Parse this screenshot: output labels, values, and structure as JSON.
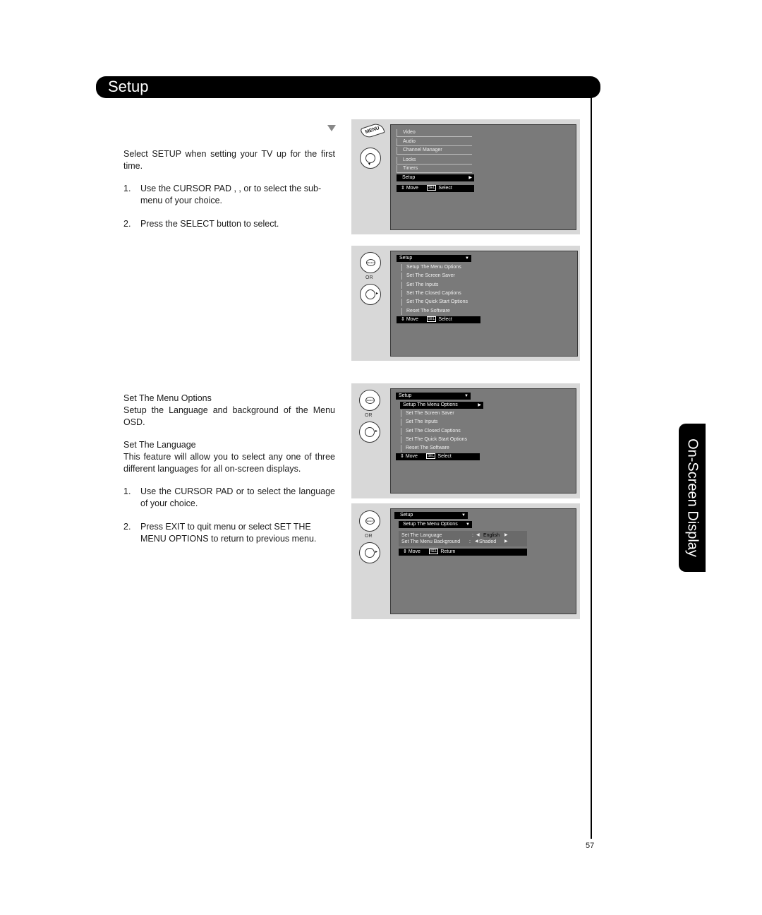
{
  "header": {
    "title": "Setup"
  },
  "side_tab": {
    "label": "On-Screen Display"
  },
  "page_number": "57",
  "section1": {
    "intro": "Select SETUP when setting your TV up for the first time.",
    "steps": [
      {
        "num": "1.",
        "text": "Use the CURSOR PAD   ,   ,    or    to select the sub-menu of your choice."
      },
      {
        "num": "2.",
        "text": "Press the SELECT button to select."
      }
    ]
  },
  "section2": {
    "heading": "Set The Menu Options",
    "desc": "Setup the Language and background of the Menu OSD.",
    "sub_heading": "Set The Language",
    "sub_desc": "This feature will allow you to select any one of three different languages for all on-screen displays.",
    "steps": [
      {
        "num": "1.",
        "text": "Use the CURSOR PAD    or    to select the language of your choice."
      },
      {
        "num": "2.",
        "text": "Press EXIT to quit menu or select SET THE MENU OPTIONS to return to previous menu."
      }
    ]
  },
  "remote": {
    "menu_label": "MENU",
    "select_label": "SELECT",
    "or_label": "OR"
  },
  "screen1": {
    "items": [
      "Video",
      "Audio",
      "Channel Manager",
      "Locks",
      "Timers"
    ],
    "selected": "Setup",
    "status": {
      "move": "Move",
      "sel_key": "SEL",
      "action": "Select"
    }
  },
  "screen2": {
    "title": "Setup",
    "items": [
      "Setup The Menu Options",
      "Set The Screen Saver",
      "Set The Inputs",
      "Set The Closed Captions",
      "Set The Quick Start Options",
      "Reset The Software"
    ],
    "status": {
      "move": "Move",
      "sel_key": "SEL",
      "action": "Select"
    }
  },
  "screen3": {
    "title": "Setup",
    "selected": "Setup The Menu Options",
    "items": [
      "Set The Screen Saver",
      "Set The Inputs",
      "Set The Closed Captions",
      "Set The Quick Start Options",
      "Reset The Software"
    ],
    "status": {
      "move": "Move",
      "sel_key": "SEL",
      "action": "Select"
    }
  },
  "screen4": {
    "title": "Setup",
    "subtitle": "Setup The Menu Options",
    "options": [
      {
        "label": "Set The Language",
        "value": "English"
      },
      {
        "label": "Set The Menu Background",
        "value": "Shaded"
      }
    ],
    "status": {
      "move": "Move",
      "sel_key": "SEL",
      "action": "Return"
    }
  }
}
